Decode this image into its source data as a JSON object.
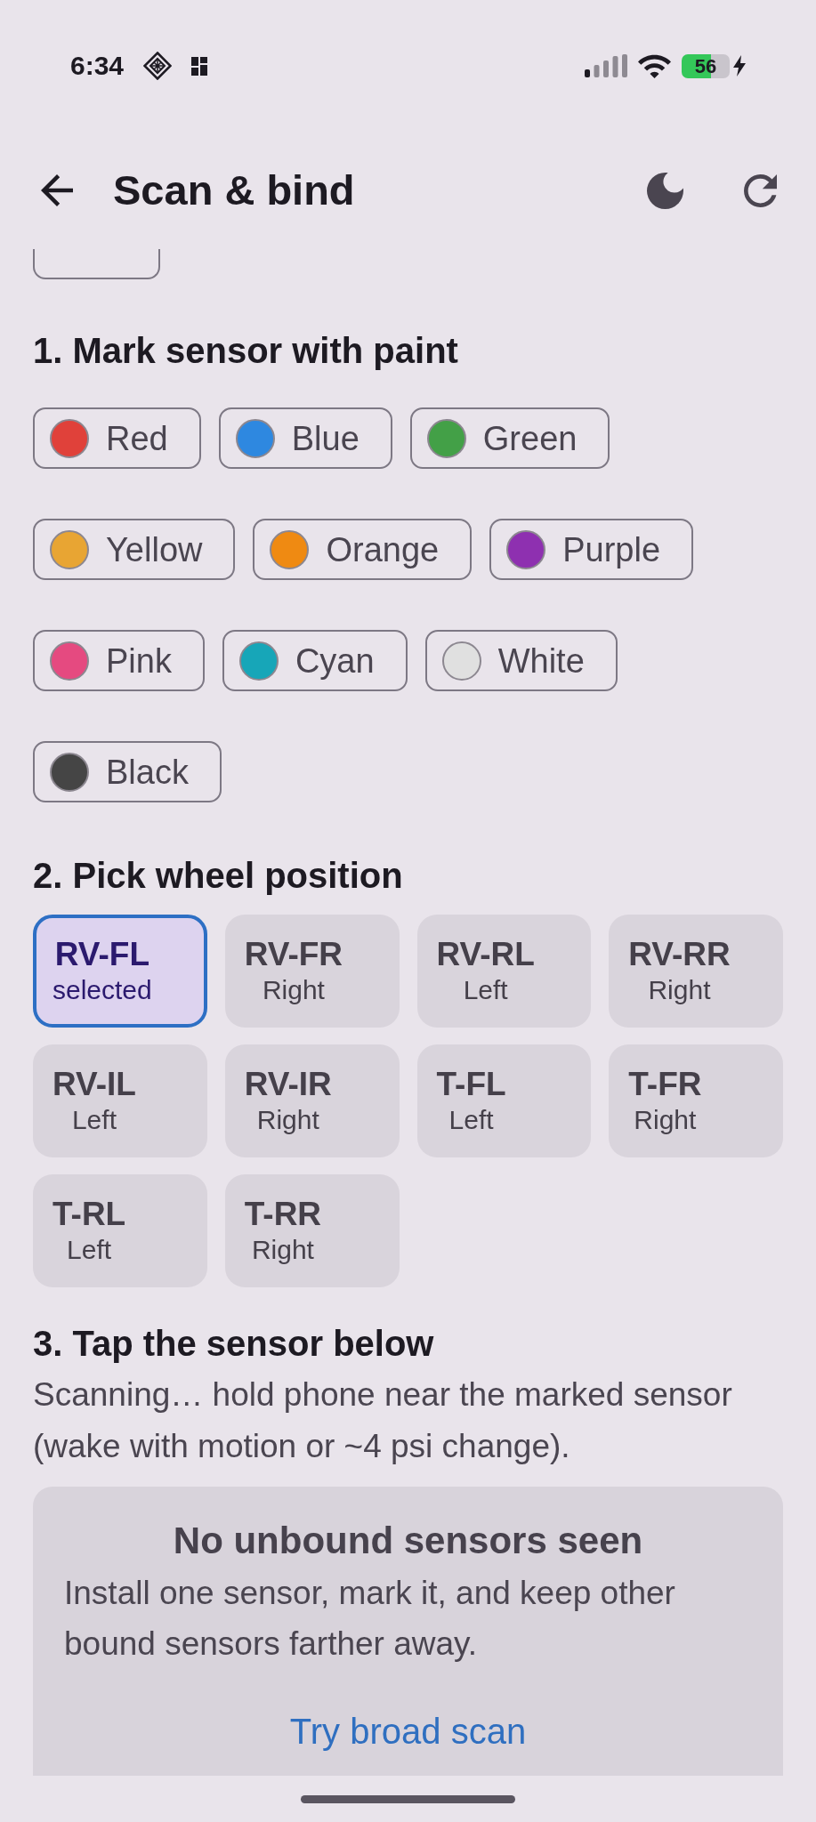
{
  "status_bar": {
    "time": "6:34",
    "battery": "56"
  },
  "header": {
    "title": "Scan & bind"
  },
  "paint_section": {
    "heading": "1. Mark sensor with paint",
    "colors": [
      {
        "label": "Red",
        "color": "#e0413a",
        "selected": false
      },
      {
        "label": "Blue",
        "color": "#2e88e0",
        "selected": false
      },
      {
        "label": "Green",
        "color": "#43a047",
        "selected": false
      },
      {
        "label": "Yellow",
        "color": "#e8a533",
        "selected": false
      },
      {
        "label": "Orange",
        "color": "#ef8a12",
        "selected": false
      },
      {
        "label": "Purple",
        "color": "#8e30b0",
        "selected": false
      },
      {
        "label": "Pink",
        "color": "#e54a80",
        "selected": false
      },
      {
        "label": "Cyan",
        "color": "#17a6b8",
        "selected": false
      },
      {
        "label": "White",
        "color": "#e0e0e0",
        "selected": false
      },
      {
        "label": "Black",
        "color": "#454545",
        "selected": false
      }
    ]
  },
  "position_section": {
    "heading": "2. Pick wheel position",
    "positions": [
      {
        "code": "RV-FL",
        "side": "selected",
        "selected": true
      },
      {
        "code": "RV-FR",
        "side": "Right",
        "selected": false
      },
      {
        "code": "RV-RL",
        "side": "Left",
        "selected": false
      },
      {
        "code": "RV-RR",
        "side": "Right",
        "selected": false
      },
      {
        "code": "RV-IL",
        "side": "Left",
        "selected": false
      },
      {
        "code": "RV-IR",
        "side": "Right",
        "selected": false
      },
      {
        "code": "T-FL",
        "side": "Left",
        "selected": false
      },
      {
        "code": "T-FR",
        "side": "Right",
        "selected": false
      },
      {
        "code": "T-RL",
        "side": "Left",
        "selected": false
      },
      {
        "code": "T-RR",
        "side": "Right",
        "selected": false
      }
    ]
  },
  "scan_section": {
    "heading": "3. Tap the sensor below",
    "status": "Scanning… hold phone near the marked sensor (wake with motion or ~4 psi change).",
    "empty_card": {
      "title": "No unbound sensors seen",
      "message": "Install one sensor, mark it, and keep other bound sensors farther away.",
      "action": "Try broad scan"
    }
  }
}
